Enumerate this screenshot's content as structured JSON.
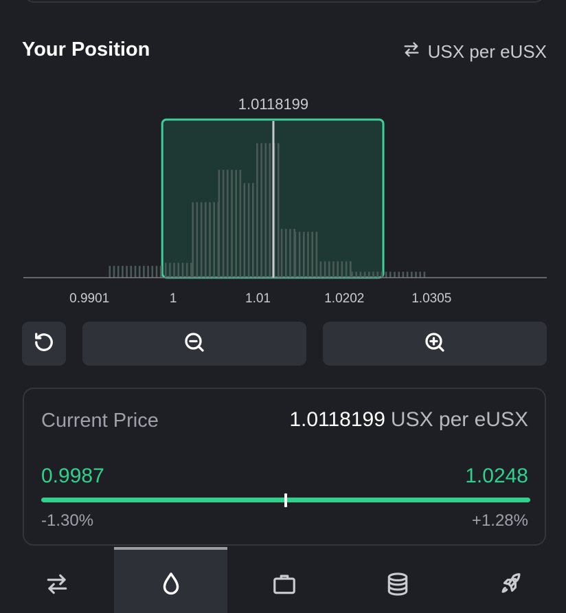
{
  "header": {
    "title": "Your Position",
    "unit_toggle": "USX per eUSX",
    "unit_toggle_icon": "swap-icon"
  },
  "chart_data": {
    "type": "bar",
    "current_price_label": "1.0118199",
    "current_price": 1.0118199,
    "selected_range": [
      0.9987,
      1.0248
    ],
    "xlim": [
      0.9823,
      1.0441
    ],
    "x_ticks": [
      {
        "value": 0.9901,
        "label": "0.9901"
      },
      {
        "value": 1.0,
        "label": "1"
      },
      {
        "value": 1.01,
        "label": "1.01"
      },
      {
        "value": 1.0202,
        "label": "1.0202"
      },
      {
        "value": 1.0305,
        "label": "1.0305"
      }
    ],
    "liquidity_bins": [
      {
        "from": 0.9924,
        "to": 0.999,
        "level": 0.08
      },
      {
        "from": 0.999,
        "to": 1.0022,
        "level": 0.1
      },
      {
        "from": 1.0022,
        "to": 1.0053,
        "level": 0.51
      },
      {
        "from": 1.0053,
        "to": 1.0083,
        "level": 0.73
      },
      {
        "from": 1.0083,
        "to": 1.0098,
        "level": 0.64
      },
      {
        "from": 1.0098,
        "to": 1.0113,
        "level": 0.91
      },
      {
        "from": 1.0113,
        "to": 1.0127,
        "level": 0.91
      },
      {
        "from": 1.0127,
        "to": 1.0143,
        "level": 0.33
      },
      {
        "from": 1.0143,
        "to": 1.0173,
        "level": 0.31
      },
      {
        "from": 1.0173,
        "to": 1.021,
        "level": 0.11
      },
      {
        "from": 1.021,
        "to": 1.03,
        "level": 0.04
      }
    ],
    "colors": {
      "range_border": "#3ccf98",
      "range_fill": "#1e3833",
      "bars": "#4a5a57",
      "current_line": "#c8c9cc",
      "axis": "#7a7c83"
    }
  },
  "controls": {
    "reset_icon": "reset-icon",
    "zoom_out_icon": "zoom-out-icon",
    "zoom_in_icon": "zoom-in-icon"
  },
  "price_card": {
    "label": "Current Price",
    "value": "1.0118199",
    "unit": "USX per eUSX",
    "min": "0.9987",
    "max": "1.0248",
    "min_pct": "-1.30%",
    "max_pct": "+1.28%",
    "position_fraction": 0.5,
    "accent": "#2fd18c"
  },
  "nav": {
    "active": "liquidity",
    "items": [
      {
        "icon": "swap-icon"
      },
      {
        "icon": "liquidity-drop-icon"
      },
      {
        "icon": "briefcase-icon"
      },
      {
        "icon": "coins-stack-icon"
      },
      {
        "icon": "rocket-icon"
      }
    ]
  }
}
